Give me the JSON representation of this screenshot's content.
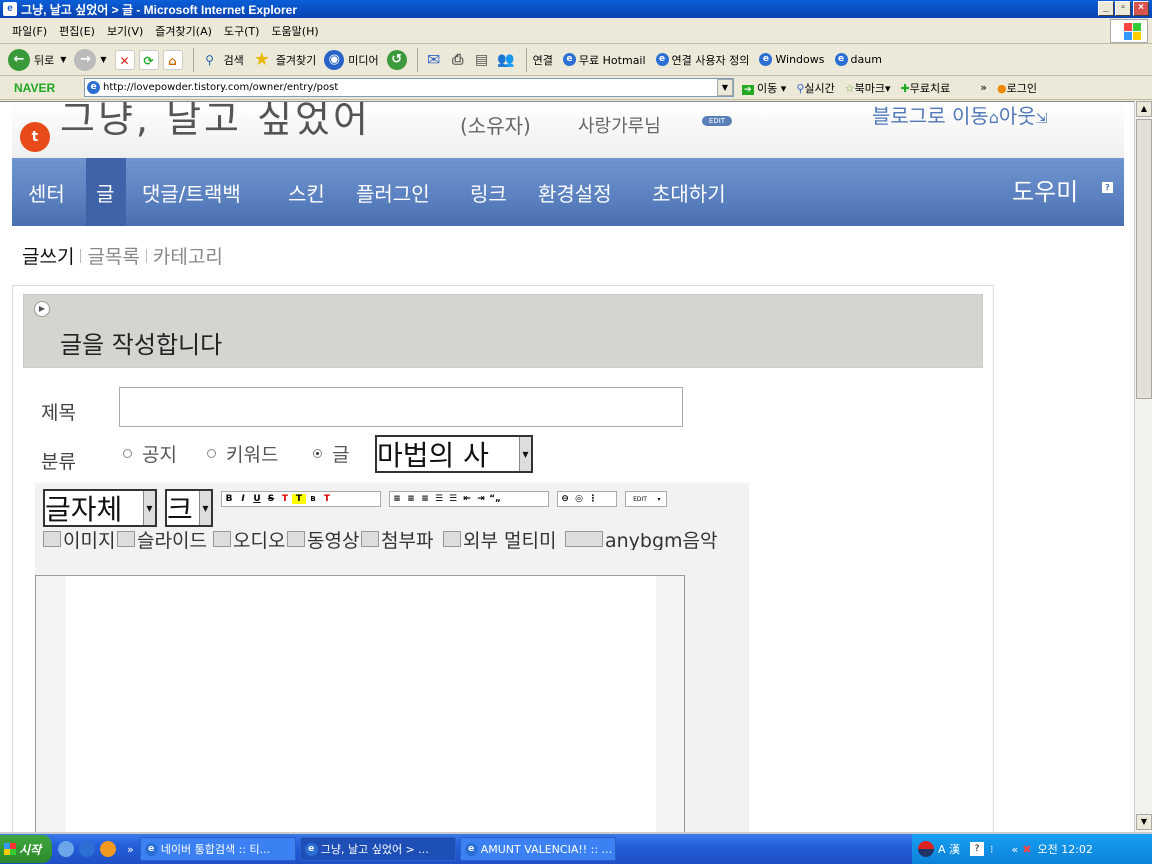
{
  "window": {
    "title": "그냥, 날고 싶었어 > 글 - Microsoft Internet Explorer",
    "minimize": "_",
    "restore": "▫",
    "close": "×"
  },
  "menu": [
    "파일(F)",
    "편집(E)",
    "보기(V)",
    "즐겨찾기(A)",
    "도구(T)",
    "도움말(H)"
  ],
  "toolbar": {
    "back": "뒤로",
    "search": "검색",
    "favorites": "즐겨찾기",
    "media": "미디어",
    "links_label": "연결",
    "links": [
      "무료 Hotmail",
      "연결 사용자 정의",
      "Windows",
      "daum"
    ]
  },
  "address": {
    "brand": "NAVER",
    "url": "http://lovepowder.tistory.com/owner/entry/post",
    "go": "이동",
    "realtime": "실시간",
    "bookmark": "북마크",
    "free": "무료치료",
    "login": "로그인"
  },
  "blog": {
    "title": "그냥, 날고 싶었어",
    "owner_label": "(소유자)",
    "owner_name": "사랑가루님",
    "edit_badge": "EDIT",
    "go_blog": "블로그로 이동"
  },
  "nav": {
    "items": [
      "센터",
      "글",
      "댓글/트랙백",
      "스킨",
      "플러그인",
      "링크",
      "환경설정",
      "초대하기"
    ],
    "help": "도우미"
  },
  "subtabs": [
    "글쓰기",
    "글목록",
    "카테고리"
  ],
  "form": {
    "heading": "글을 작성합니다",
    "title_label": "제목",
    "category_label": "분류",
    "radios": [
      "공지",
      "키워드",
      "글"
    ],
    "category_value": "마법의 사",
    "font_select": "글자체",
    "size_select": "크",
    "fmt_buttons": [
      "B",
      "I",
      "U",
      "S",
      "T",
      "T",
      "B",
      "T"
    ],
    "align_buttons": [
      "≡",
      "≡",
      "≡",
      "☰",
      "☰",
      "⇤",
      "⇥",
      "“„"
    ],
    "edit_badge": "EDIT",
    "media_buttons": [
      "이미지",
      "슬라이드",
      "오디오",
      "동영상",
      "첨부파",
      "외부 멀티미",
      "anybgm음악"
    ]
  },
  "taskbar": {
    "start": "시작",
    "tasks": [
      "네이버 통합검색 :: 티...",
      "그냥, 날고 싶었어 > ...",
      "AMUNT VALENCIA!! :: ..."
    ],
    "time": "오전 12:02",
    "ime": "A 漢"
  }
}
